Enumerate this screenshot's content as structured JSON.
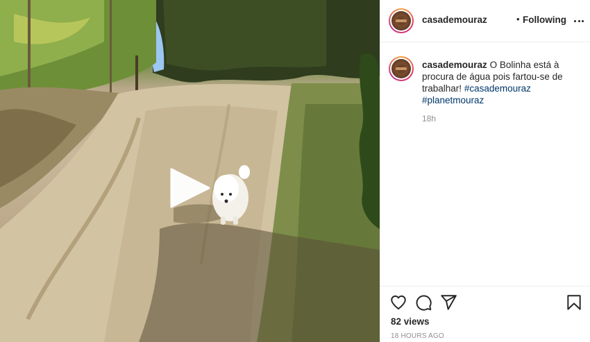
{
  "media": {
    "type": "video",
    "play_icon": "play-icon"
  },
  "header": {
    "username": "casademouraz",
    "separator": "•",
    "follow_status": "Following",
    "more_icon": "more-horizontal-icon"
  },
  "caption": {
    "username": "casademouraz",
    "text": "O Bolinha está à procura de água pois fartou-se de trabalhar!",
    "hashtags": [
      "#casademouraz",
      "#planetmouraz"
    ],
    "time": "18h"
  },
  "actions": {
    "like_icon": "heart-icon",
    "comment_icon": "comment-icon",
    "share_icon": "share-icon",
    "save_icon": "bookmark-icon",
    "views": "82 views",
    "posted": "18 HOURS AGO"
  }
}
